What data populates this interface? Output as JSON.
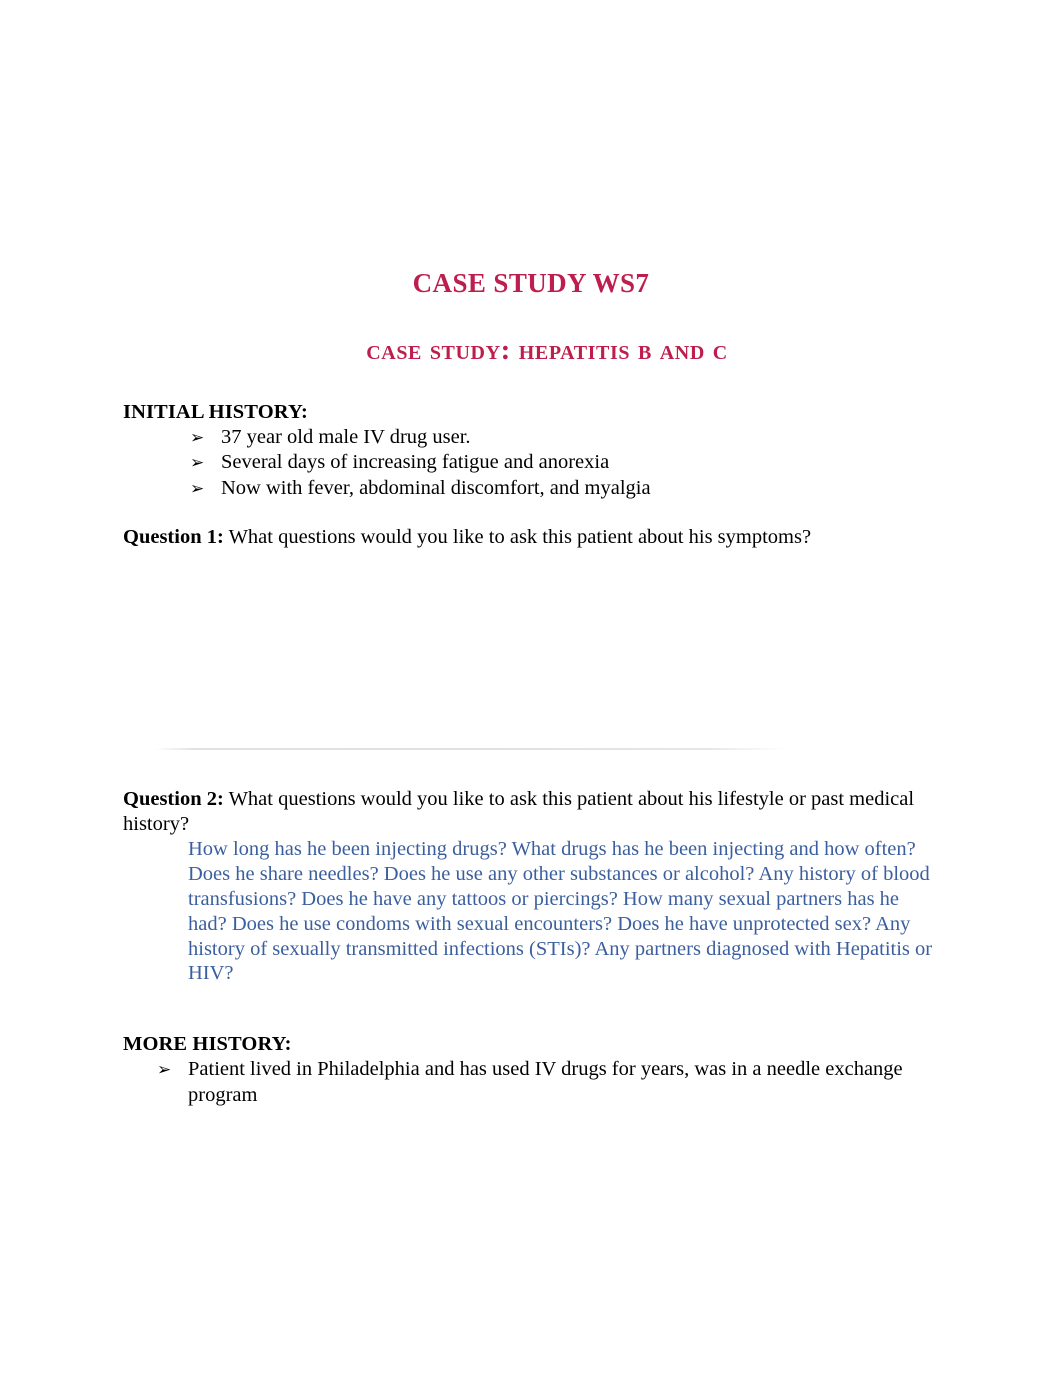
{
  "document": {
    "title": "CASE STUDY WS7",
    "subtitle": "Case Study:  Hepatitis b and C",
    "title_color": "#be1e4e",
    "answer_color": "#3b5f9e",
    "bullet_glyph": "➢"
  },
  "sections": {
    "initial_history": {
      "heading": "INITIAL HISTORY:",
      "bullets": [
        "37 year old male IV drug user.",
        "Several days of increasing fatigue and anorexia",
        "Now with fever, abdominal discomfort, and myalgia"
      ]
    },
    "question1": {
      "label": "Question 1:",
      "text": "What questions would you like to ask this patient about his symptoms?",
      "answer": ""
    },
    "question2": {
      "label": "Question 2:",
      "text": "What questions would you like to ask this patient about his lifestyle or past medical history?",
      "answer": "How long has he been injecting drugs? What drugs has he been injecting and how often? Does he share needles? Does he use any other substances or alcohol? Any history of blood transfusions? Does he have any tattoos or piercings? How many sexual partners has he had? Does he use condoms with sexual encounters? Does he have unprotected sex? Any history of sexually transmitted infections (STIs)? Any partners diagnosed with Hepatitis or HIV?"
    },
    "more_history": {
      "heading": "MORE HISTORY:",
      "bullets": [
        "Patient lived in Philadelphia and has used IV drugs for years, was in a needle exchange program"
      ]
    }
  }
}
